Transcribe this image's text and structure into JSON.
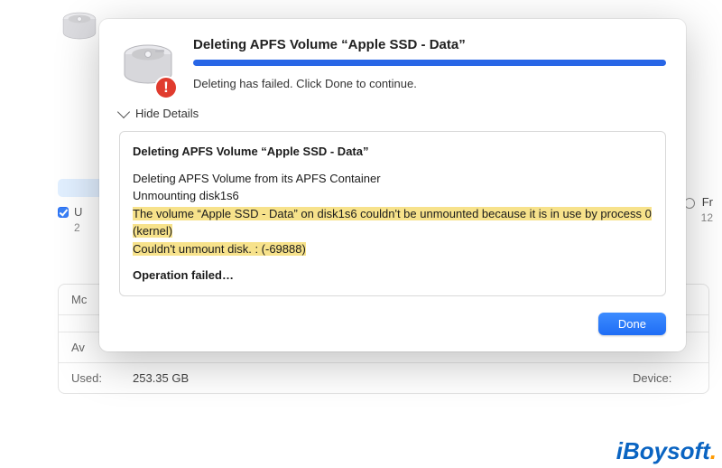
{
  "background": {
    "sidebar_item_letter": "U",
    "sidebar_sub": "2",
    "right_radio_label": "Fr",
    "right_sub": "12",
    "detail_rows": {
      "r1k": "Mc",
      "r1v": "",
      "r2k": "",
      "r2v": "",
      "r3k": "Av",
      "r3v": "",
      "r4k": "Used:",
      "r4v1": "253.35 GB",
      "r4k2": "Device:"
    }
  },
  "sheet": {
    "title": "Deleting APFS Volume “Apple SSD - Data”",
    "status": "Deleting has failed. Click Done to continue.",
    "toggle_label": "Hide Details",
    "log": {
      "heading": "Deleting APFS Volume “Apple SSD - Data”",
      "line1": "Deleting APFS Volume from its APFS Container",
      "line2": "Unmounting disk1s6",
      "hl1": "The volume “Apple SSD - Data” on disk1s6 couldn't be unmounted because it is in use by process 0 (kernel)",
      "hl2": "Couldn't unmount disk. : (-69888)",
      "fail": "Operation failed…"
    },
    "done_label": "Done"
  },
  "watermark": "iBoysoft"
}
